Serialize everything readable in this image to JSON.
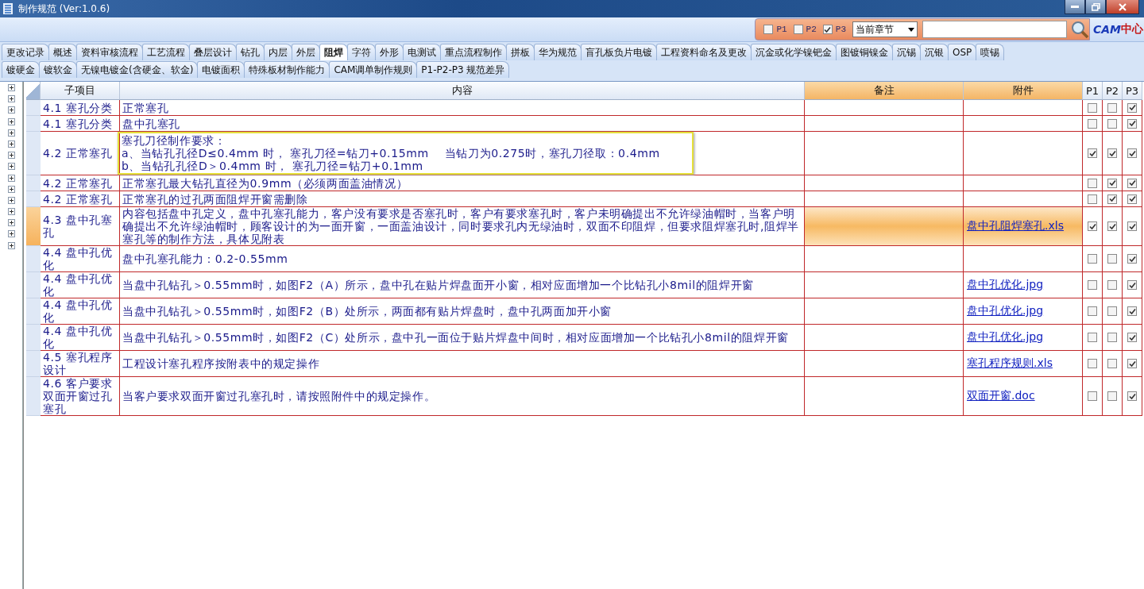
{
  "window": {
    "title": "制作规范 (Ver:1.0.6)"
  },
  "filter": {
    "checks": [
      {
        "label": "P1",
        "checked": false
      },
      {
        "label": "P2",
        "checked": false
      },
      {
        "label": "P3",
        "checked": true
      }
    ],
    "scope": "当前章节",
    "logo": {
      "latin": "CAM",
      "cjk": "中心"
    }
  },
  "tab_rows": [
    [
      {
        "label": "更改记录",
        "selected": false
      },
      {
        "label": "概述",
        "selected": false
      },
      {
        "label": "资料审核流程",
        "selected": false
      },
      {
        "label": "工艺流程",
        "selected": false
      },
      {
        "label": "叠层设计",
        "selected": false
      },
      {
        "label": "钻孔",
        "selected": false
      },
      {
        "label": "内层",
        "selected": false
      },
      {
        "label": "外层",
        "selected": false
      },
      {
        "label": "阻焊",
        "selected": true
      },
      {
        "label": "字符",
        "selected": false
      },
      {
        "label": "外形",
        "selected": false
      },
      {
        "label": "电测试",
        "selected": false
      },
      {
        "label": "重点流程制作",
        "selected": false
      },
      {
        "label": "拼板",
        "selected": false
      },
      {
        "label": "华为规范",
        "selected": false
      },
      {
        "label": "盲孔板负片电镀",
        "selected": false
      },
      {
        "label": "工程资料命名及更改",
        "selected": false
      },
      {
        "label": "沉金或化学镍钯金",
        "selected": false
      },
      {
        "label": "图镀铜镍金",
        "selected": false
      },
      {
        "label": "沉锡",
        "selected": false
      },
      {
        "label": "沉银",
        "selected": false
      },
      {
        "label": "OSP",
        "selected": false
      },
      {
        "label": "喷锡",
        "selected": false
      }
    ],
    [
      {
        "label": "镀硬金",
        "selected": false
      },
      {
        "label": "镀软金",
        "selected": false
      },
      {
        "label": "无镍电镀金(含硬金、软金)",
        "selected": false
      },
      {
        "label": "电镀面积",
        "selected": false
      },
      {
        "label": "特殊板材制作能力",
        "selected": false
      },
      {
        "label": "CAM调单制作规则",
        "selected": false
      },
      {
        "label": "P1-P2-P3 规范差异",
        "selected": false
      }
    ]
  ],
  "tree": {
    "nodes": [
      {
        "expanded": false
      },
      {
        "expanded": false
      },
      {
        "expanded": false
      },
      {
        "expanded": false
      },
      {
        "expanded": false
      },
      {
        "expanded": false
      },
      {
        "expanded": false
      },
      {
        "expanded": false
      },
      {
        "expanded": false
      },
      {
        "expanded": false
      },
      {
        "expanded": false
      },
      {
        "expanded": false
      },
      {
        "expanded": false
      },
      {
        "expanded": false
      },
      {
        "expanded": false
      }
    ]
  },
  "table": {
    "columns": [
      "子项目",
      "内容",
      "备注",
      "附件",
      "P1",
      "P2",
      "P3"
    ],
    "rows": [
      {
        "item": "4.1 塞孔分类",
        "content": "正常塞孔",
        "checks": [
          false,
          false,
          true
        ],
        "selected": false,
        "highlighted": false
      },
      {
        "item": "4.1 塞孔分类",
        "content": "盘中孔塞孔",
        "checks": [
          false,
          false,
          true
        ],
        "selected": false,
        "highlighted": false
      },
      {
        "item": "4.2 正常塞孔",
        "content": "塞孔刀径制作要求：\na、当钻孔孔径D≤0.4mm 时， 塞孔刀径=钻刀+0.15mm    当钻刀为0.275时，塞孔刀径取：0.4mm\nb、当钻孔孔径D＞0.4mm 时， 塞孔刀径=钻刀+0.1mm",
        "checks": [
          true,
          true,
          true
        ],
        "selected": false,
        "highlighted": true
      },
      {
        "item": "4.2 正常塞孔",
        "content": "正常塞孔最大钻孔直径为0.9mm（必须两面盖油情况）",
        "checks": [
          false,
          true,
          true
        ],
        "selected": false,
        "highlighted": false
      },
      {
        "item": "4.2 正常塞孔",
        "content": "正常塞孔的过孔两面阻焊开窗需删除",
        "checks": [
          false,
          true,
          true
        ],
        "selected": false,
        "highlighted": false
      },
      {
        "item": "4.3 盘中孔塞孔",
        "content": "内容包括盘中孔定义，盘中孔塞孔能力，客户没有要求是否塞孔时，客户有要求塞孔时，客户未明确提出不允许绿油帽时，当客户明确提出不允许绿油帽时，顾客设计的为一面开窗，一面盖油设计，同时要求孔内无绿油时，双面不印阻焊，但要求阻焊塞孔时,阻焊半塞孔等的制作方法，具体见附表",
        "attachment": "盘中孔阻焊塞孔.xls",
        "checks": [
          true,
          true,
          true
        ],
        "selected": true,
        "highlighted": false
      },
      {
        "item": "4.4 盘中孔优化",
        "content": "盘中孔塞孔能力：0.2-0.55mm",
        "checks": [
          false,
          false,
          true
        ],
        "selected": false,
        "highlighted": false
      },
      {
        "item": "4.4 盘中孔优化",
        "content": "当盘中孔钻孔＞0.55mm时，如图F2（A）所示，盘中孔在贴片焊盘面开小窗，相对应面增加一个比钻孔小8mil的阻焊开窗",
        "attachment": "盘中孔优化.jpg",
        "checks": [
          false,
          false,
          true
        ],
        "selected": false,
        "highlighted": false
      },
      {
        "item": "4.4 盘中孔优化",
        "content": "当盘中孔钻孔＞0.55mm时，如图F2（B）处所示，两面都有贴片焊盘时，盘中孔两面加开小窗",
        "attachment": "盘中孔优化.jpg",
        "checks": [
          false,
          false,
          true
        ],
        "selected": false,
        "highlighted": false
      },
      {
        "item": "4.4 盘中孔优化",
        "content": "当盘中孔钻孔＞0.55mm时，如图F2（C）处所示，盘中孔一面位于贴片焊盘中间时，相对应面增加一个比钻孔小8mil的阻焊开窗",
        "attachment": "盘中孔优化.jpg",
        "checks": [
          false,
          false,
          true
        ],
        "selected": false,
        "highlighted": false
      },
      {
        "item": "4.5 塞孔程序设计",
        "content": "工程设计塞孔程序按附表中的规定操作",
        "attachment": "塞孔程序规则.xls",
        "checks": [
          false,
          false,
          true
        ],
        "selected": false,
        "highlighted": false
      },
      {
        "item": "4.6 客户要求双面开窗过孔塞孔",
        "content": "当客户要求双面开窗过孔塞孔时，请按照附件中的规定操作。",
        "attachment": "双面开窗.doc",
        "checks": [
          false,
          false,
          true
        ],
        "selected": false,
        "highlighted": false
      }
    ]
  }
}
